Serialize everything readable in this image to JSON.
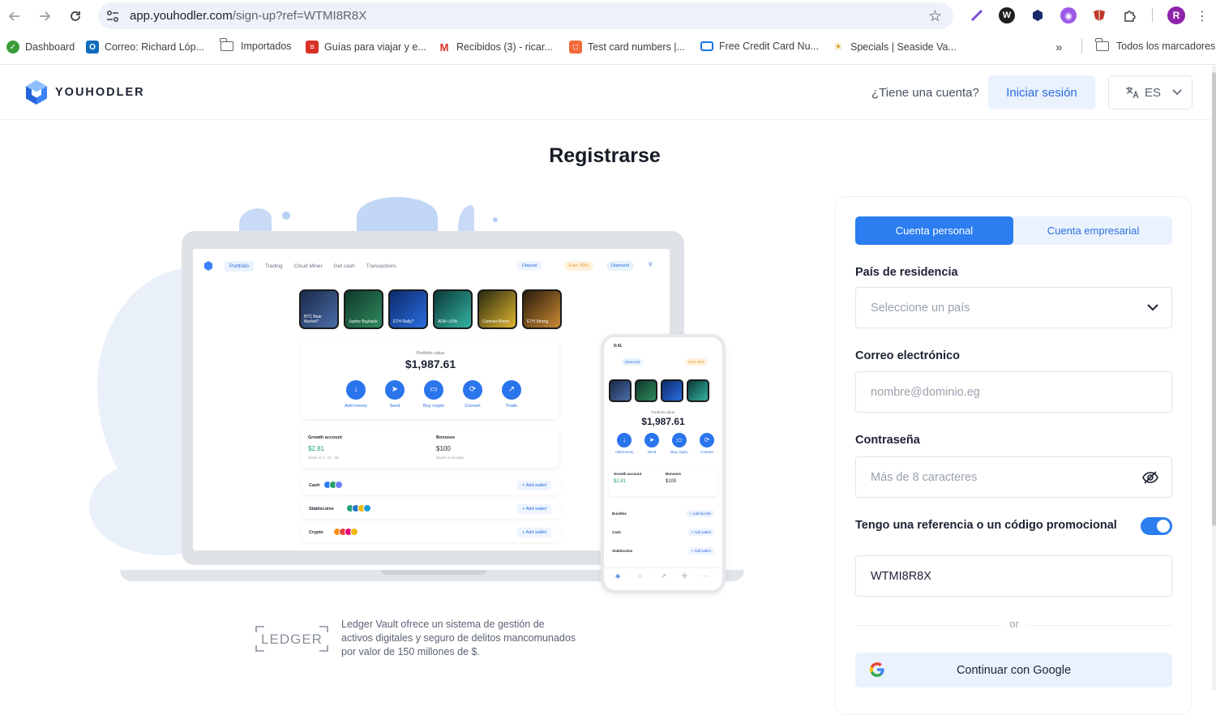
{
  "browser": {
    "url_host": "app.youhodler.com",
    "url_path": "/sign-up?ref=WTMI8R8X",
    "profile_initial": "R",
    "bookmarks": [
      {
        "label": "Dashboard"
      },
      {
        "label": "Correo: Richard Lóp..."
      },
      {
        "label": "Importados"
      },
      {
        "label": "Guías para viajar y e..."
      },
      {
        "label": "Recibidos (3) - ricar..."
      },
      {
        "label": "Test card numbers |..."
      },
      {
        "label": "Free Credit Card Nu..."
      },
      {
        "label": "Specials | Seaside Va..."
      }
    ],
    "overflow_label": "»",
    "all_bookmarks": "Todos los marcadores"
  },
  "header": {
    "brand": "YOUHODLER",
    "has_account": "¿Tiene una cuenta?",
    "login": "Iniciar sesión",
    "language": "ES"
  },
  "main": {
    "title": "Registrarse"
  },
  "illustration": {
    "nav": [
      "Portfolio",
      "Trading",
      "Cloud Miner",
      "Get cash",
      "Transactions"
    ],
    "deposit": "Deposit",
    "earn": "Earn 30%",
    "tier": "Diamond",
    "stories": [
      "BTC Bear Market?",
      "Jupiter Buyback",
      "ETH Rally?",
      "ADA +15%",
      "Contract Boom",
      "ETH Strong"
    ],
    "portfolio_label": "Portfolio value",
    "portfolio_value": "$1,987.61",
    "actions": [
      "Add money",
      "Send",
      "Buy crypto",
      "Convert",
      "Trade"
    ],
    "growth_label": "Growth account",
    "growth_value": "$2.81",
    "growth_sub": "Claim in 4 : 27 : 56",
    "bonuses_label": "Bonuses",
    "bonuses_value": "$100",
    "bonuses_sub": "Expire in 26 days",
    "wallets": [
      {
        "name": "Cash",
        "add": "+ Add wallet"
      },
      {
        "name": "Stablecoins",
        "add": "+ Add wallet"
      },
      {
        "name": "Crypto",
        "add": "+ Add wallet"
      }
    ],
    "phone_time": "9:41",
    "phone_bundles": "Bundles",
    "phone_add_bundle": "+ Add bundle",
    "phone_actions": [
      "Add money",
      "Send",
      "Buy crypto",
      "Convert"
    ]
  },
  "ledger": {
    "logo": "LEDGER",
    "text": "Ledger Vault ofrece un sistema de gestión de activos digitales y seguro de delitos mancomunados por valor de 150 millones de $."
  },
  "form": {
    "tabs": [
      "Cuenta personal",
      "Cuenta empresarial"
    ],
    "country_label": "País de residencia",
    "country_placeholder": "Seleccione un país",
    "email_label": "Correo electrónico",
    "email_placeholder": "nombre@dominio.eg",
    "password_label": "Contraseña",
    "password_placeholder": "Más de 8 caracteres",
    "referral_label": "Tengo una referencia o un código promocional",
    "referral_on": true,
    "referral_code": "WTMI8R8X",
    "or": "or",
    "google": "Continuar con Google"
  },
  "colors": {
    "accent": "#2b7df0",
    "accent_light": "#e9f2fd",
    "text": "#1d2233"
  }
}
